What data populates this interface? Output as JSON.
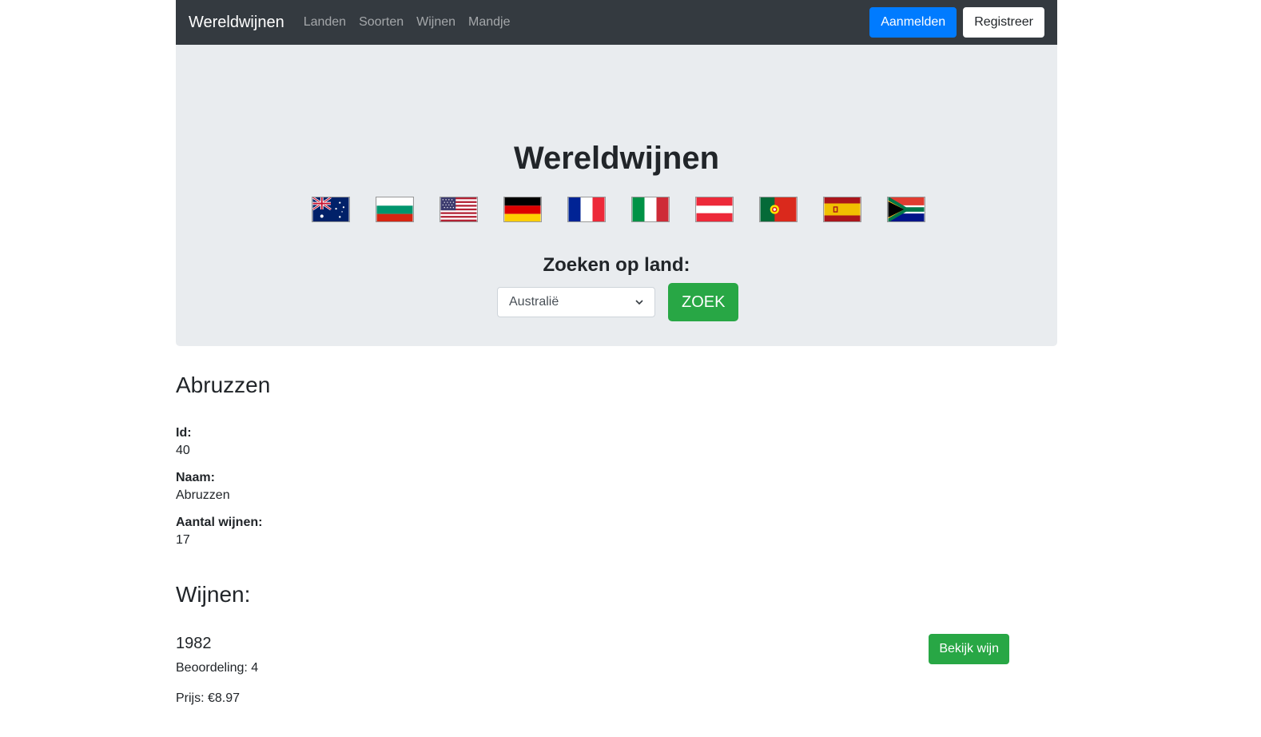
{
  "nav": {
    "brand": "Wereldwijnen",
    "links": [
      "Landen",
      "Soorten",
      "Wijnen",
      "Mandje"
    ],
    "login": "Aanmelden",
    "register": "Registreer"
  },
  "hero": {
    "title": "Wereldwijnen",
    "flags": [
      "australia-flag",
      "bulgaria-flag",
      "usa-flag",
      "germany-flag",
      "france-flag",
      "italy-flag",
      "austria-flag",
      "portugal-flag",
      "spain-flag",
      "south-africa-flag"
    ],
    "search_label": "Zoeken op land:",
    "select_value": "Australië",
    "search_button": "ZOEK"
  },
  "region": {
    "title": "Abruzzen",
    "id_label": "Id:",
    "id_value": "40",
    "name_label": "Naam:",
    "name_value": "Abruzzen",
    "count_label": "Aantal wijnen:",
    "count_value": "17"
  },
  "wines": {
    "heading": "Wijnen:",
    "items": [
      {
        "year": "1982",
        "rating": "Beoordeling: 4",
        "price": "Prijs: €8.97",
        "button": "Bekijk wijn"
      }
    ]
  },
  "colors": {
    "navbar": "#343a40",
    "primary": "#007bff",
    "success": "#28a745",
    "jumbotron": "#e9ecef"
  }
}
